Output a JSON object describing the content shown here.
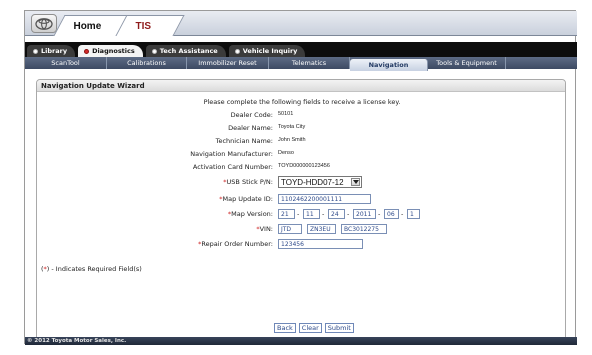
{
  "app": {
    "tabs": [
      {
        "label": "Home"
      },
      {
        "label": "TIS"
      }
    ]
  },
  "modules": [
    {
      "label": "Library"
    },
    {
      "label": "Diagnostics"
    },
    {
      "label": "Tech Assistance"
    },
    {
      "label": "Vehicle Inquiry"
    }
  ],
  "subnav": [
    {
      "label": "ScanTool"
    },
    {
      "label": "Calibrations"
    },
    {
      "label": "Immobilizer Reset"
    },
    {
      "label": "Telematics"
    },
    {
      "label": "Navigation"
    },
    {
      "label": "Tools & Equipment"
    }
  ],
  "wizard": {
    "title": "Navigation Update Wizard",
    "intro": "Please complete the following fields to receive a license key.",
    "dealer_code_label": "Dealer Code:",
    "dealer_code": "50101",
    "dealer_name_label": "Dealer Name:",
    "dealer_name": "Toyota City",
    "technician_label": "Technician Name:",
    "technician": "John Smith",
    "manufacturer_label": "Navigation Manufacturer:",
    "manufacturer": "Denso",
    "activation_label": "Activation Card Number:",
    "activation": "TOYD000000123456",
    "required_mark": "*",
    "usb_label": "USB Stick P/N:",
    "usb_value": "TOYD-HDD07-12",
    "map_update_label": "Map Update ID:",
    "map_update_id": "1102462200001111",
    "map_version_label": "Map Version:",
    "map_version": [
      "21",
      "11",
      "24",
      "2011",
      "06",
      "1"
    ],
    "dash": "-",
    "vin_label": "VIN:",
    "vin": [
      "JTD",
      "ZN3EU",
      "BC3012275"
    ],
    "ro_label": "Repair Order Number:",
    "ro_number": "123456",
    "note_prefix": "(",
    "note_suffix": ") - Indicates Required Field(s)"
  },
  "buttons": {
    "back": "Back",
    "clear": "Clear",
    "submit": "Submit"
  },
  "footer": {
    "copyright": "© 2012 Toyota Motor Sales, Inc."
  },
  "colors": {
    "required": "#cc1f1f",
    "brand_dark": "#0d0d0d",
    "subnav": "#4a5875",
    "input_text": "#2e4a8a"
  }
}
